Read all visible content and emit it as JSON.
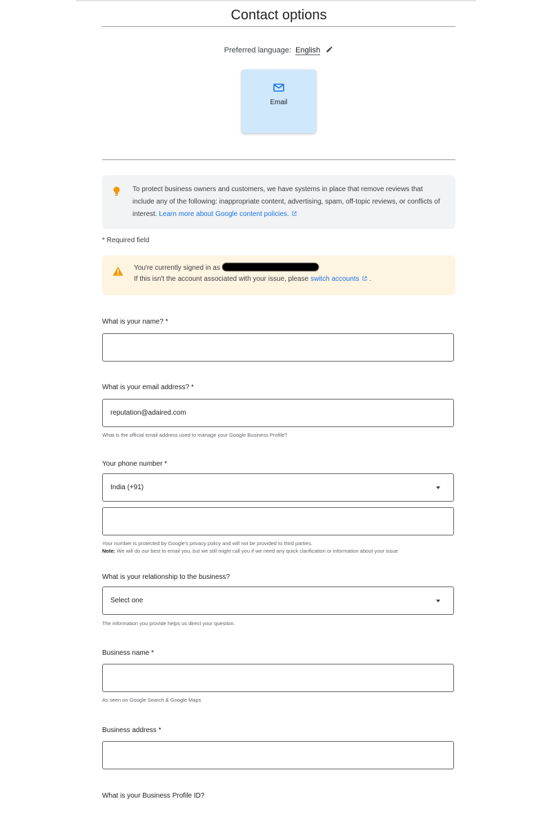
{
  "page": {
    "title": "Contact options"
  },
  "language": {
    "label": "Preferred language:",
    "value": "English"
  },
  "contact_options": [
    {
      "label": "Email",
      "icon": "email-icon",
      "selected": true
    }
  ],
  "info_notice": {
    "text": "To protect business owners and customers, we have systems in place that remove reviews that include any of the following: inappropriate content, advertising, spam, off-topic reviews, or conflicts of interest.",
    "link": "Learn more about Google content policies."
  },
  "required_note": "* Required field",
  "signed_in_notice": {
    "line1_prefix": "You're currently signed in as",
    "line2_prefix": "If this isn't the account associated with your issue, please",
    "link": "switch accounts",
    "line2_suffix": "."
  },
  "form": {
    "name": {
      "label": "What is your name? *",
      "value": ""
    },
    "email": {
      "label": "What is your email address? *",
      "value": "reputation@adaired.com",
      "helper": "What is the official email address used to manage your Google Business Profile?"
    },
    "phone": {
      "label": "Your phone number *",
      "country": "India (+91)",
      "value": "",
      "helper": "Your number is protected by Google's privacy policy and will not be provided to third parties.",
      "note_label": "Note:",
      "note_text": "We will do our best to email you, but we still might call you if we need any quick clarification or information about your issue"
    },
    "relationship": {
      "label": "What is your relationship to the business?",
      "selected": "Select one",
      "helper": "The information you provide helps us direct your question."
    },
    "business_name": {
      "label": "Business name *",
      "value": "",
      "helper": "As seen on Google Search & Google Maps"
    },
    "business_address": {
      "label": "Business address *",
      "value": ""
    },
    "profile_id": {
      "label": "What is your Business Profile ID?"
    }
  },
  "colors": {
    "accent": "#1a73e8",
    "email_card": "#cfe8fc",
    "info_bg": "#f1f3f4",
    "warning_bg": "#fef4e2",
    "bulb": "#f29900",
    "warning": "#f29900"
  }
}
